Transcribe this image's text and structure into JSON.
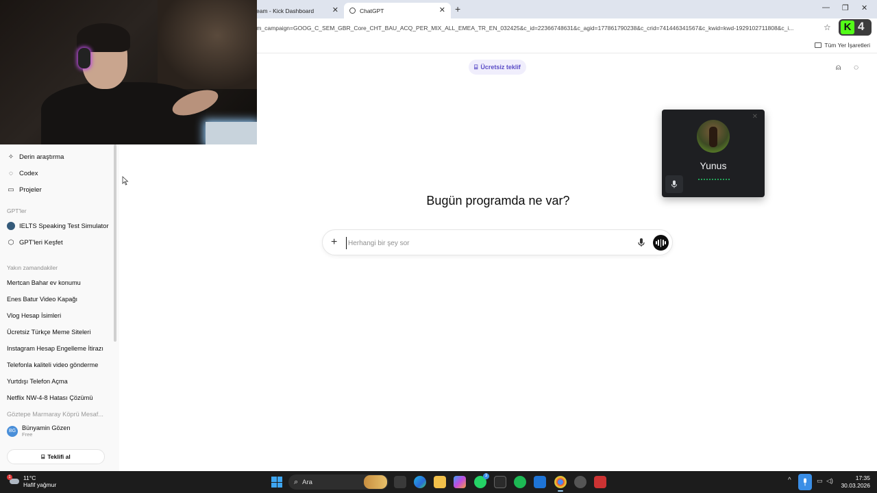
{
  "browser": {
    "tabs": [
      {
        "label": "eam - Kick Dashboard"
      },
      {
        "label": "ChatGPT"
      }
    ],
    "url": "tm_campaign=GOOG_C_SEM_GBR_Core_CHT_BAU_ACQ_PER_MIX_ALL_EMEA_TR_EN_032425&c_id=22366748631&c_agid=177861790238&c_crid=741446341567&c_kwid=kwd-1929102711808&c_i...",
    "extension_letter": "K",
    "extension_count": "4",
    "bookmarks_all": "Tüm Yer İşaretleri"
  },
  "sidebar": {
    "nav": [
      {
        "label": "Derin araştırma",
        "icon": "telescope-icon"
      },
      {
        "label": "Codex",
        "icon": "codex-icon"
      },
      {
        "label": "Projeler",
        "icon": "folder-icon"
      }
    ],
    "gpts_section": "GPT'ler",
    "gpts": [
      {
        "label": "IELTS Speaking Test Simulator",
        "icon": "ielts-avatar-icon"
      },
      {
        "label": "GPT'leri Keşfet",
        "icon": "cube-icon"
      }
    ],
    "recent_section": "Yakın zamandakiler",
    "recent": [
      {
        "label": "Mertcan Bahar ev konumu"
      },
      {
        "label": "Enes Batur Video Kapağı"
      },
      {
        "label": "Vlog Hesap İsimleri"
      },
      {
        "label": "Ücretsiz Türkçe Meme Siteleri"
      },
      {
        "label": "Instagram Hesap Engelleme İtirazı"
      },
      {
        "label": "Telefonla kaliteli video gönderme"
      },
      {
        "label": "Yurtdışı Telefon Açma"
      },
      {
        "label": "Netflix NW-4-8 Hatası Çözümü"
      },
      {
        "label": "Göztepe Marmaray Köprü Mesaf..."
      }
    ],
    "user": {
      "initials": "BG",
      "name": "Bünyamin Gözen",
      "plan": "Free"
    },
    "offer_button": "Teklifi al"
  },
  "main": {
    "free_offer": "Ücretsiz teklif",
    "headline": "Bugün programda ne var?",
    "composer": {
      "placeholder": "Herhangi bir şey sor",
      "value": ""
    }
  },
  "call": {
    "name": "Yunus"
  },
  "taskbar": {
    "weather_temp": "11°C",
    "weather_desc": "Hafif yağmur",
    "weather_badge": "1",
    "search_label": "Ara",
    "whatsapp_badge": "3",
    "time": "17:35",
    "date": "30.03.2026"
  },
  "colors": {
    "accent_offer": "#5b4dc7",
    "kick_green": "#53fc18",
    "taskbar": "#1c1c1c",
    "sidebar": "#f9f9f9"
  }
}
